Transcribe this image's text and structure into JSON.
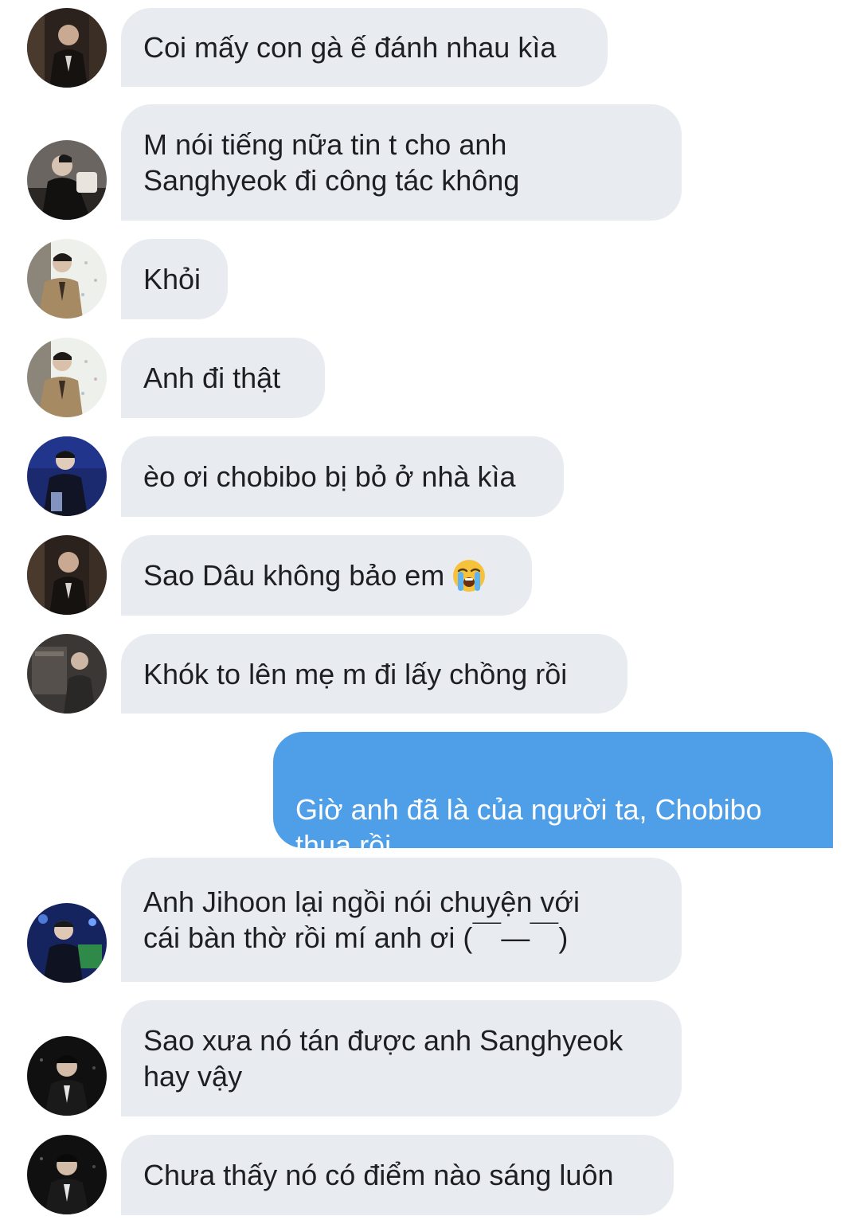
{
  "conversation": {
    "messages": [
      {
        "side": "in",
        "avatar": "avatar-dark-suit-icon",
        "text": "Coi mấy con gà ế đánh nhau kìa"
      },
      {
        "side": "in",
        "avatar": "avatar-black-coat-icon",
        "text": "M nói tiếng nữa tin t cho anh\nSanghyeok đi công tác không"
      },
      {
        "side": "in",
        "avatar": "avatar-beige-blazer-icon",
        "text": "Khỏi"
      },
      {
        "side": "in",
        "avatar": "avatar-beige-blazer-icon",
        "text": "Anh đi thật"
      },
      {
        "side": "in",
        "avatar": "avatar-navy-stage-icon",
        "text": "èo ơi chobibo bị bỏ ở nhà kìa"
      },
      {
        "side": "in",
        "avatar": "avatar-dark-suit-icon",
        "text": "Sao Dâu không bảo em",
        "emoji": "loudly-crying-face-icon"
      },
      {
        "side": "in",
        "avatar": "avatar-grey-room-icon",
        "text": "Khók to lên mẹ m đi lấy chồng rồi"
      },
      {
        "side": "out",
        "text": "Giờ anh đã là của người ta, Chobibo\nthua rồi"
      },
      {
        "side": "in",
        "avatar": "avatar-blue-stage-icon",
        "text": "Anh Jihoon lại ngồi nói chuyện với\ncái bàn thờ rồi mí anh ơi (￣—￣)"
      },
      {
        "side": "in",
        "avatar": "avatar-black-portrait-icon",
        "text": "Sao xưa nó tán được anh Sanghyeok\nhay vậy"
      },
      {
        "side": "in",
        "avatar": "avatar-black-portrait-icon",
        "text": "Chưa thấy nó có điểm nào sáng luôn"
      }
    ]
  },
  "colors": {
    "incoming_bubble": "#e8ebf0",
    "outgoing_bubble": "#4f9fe8",
    "incoming_text": "#1d1f22",
    "outgoing_text": "#ffffff"
  }
}
